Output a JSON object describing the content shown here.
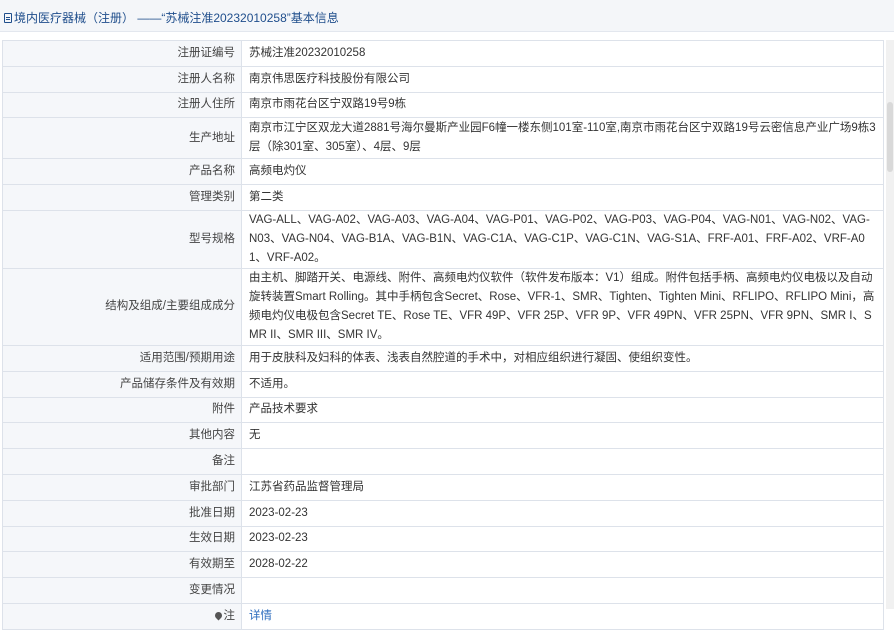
{
  "header": {
    "title": "境内医疗器械（注册） ——“苏械注准20232010258”基本信息"
  },
  "rows": [
    {
      "label": "注册证编号",
      "value": "苏械注准20232010258"
    },
    {
      "label": "注册人名称",
      "value": "南京伟思医疗科技股份有限公司"
    },
    {
      "label": "注册人住所",
      "value": "南京市雨花台区宁双路19号9栋"
    },
    {
      "label": "生产地址",
      "value": "南京市江宁区双龙大道2881号海尔曼斯产业园F6幢一楼东侧101室-110室,南京市雨花台区宁双路19号云密信息产业广场9栋3层（除301室、305室）、4层、9层"
    },
    {
      "label": "产品名称",
      "value": "高频电灼仪"
    },
    {
      "label": "管理类别",
      "value": "第二类"
    },
    {
      "label": "型号规格",
      "value": "VAG-ALL、VAG-A02、VAG-A03、VAG-A04、VAG-P01、VAG-P02、VAG-P03、VAG-P04、VAG-N01、VAG-N02、VAG-N03、VAG-N04、VAG-B1A、VAG-B1N、VAG-C1A、VAG-C1P、VAG-C1N、VAG-S1A、FRF-A01、FRF-A02、VRF-A01、VRF-A02。"
    },
    {
      "label": "结构及组成/主要组成成分",
      "value": "由主机、脚踏开关、电源线、附件、高频电灼仪软件（软件发布版本：V1）组成。附件包括手柄、高频电灼仪电极以及自动旋转装置Smart Rolling。其中手柄包含Secret、Rose、VFR-1、SMR、Tighten、Tighten Mini、RFLIPO、RFLIPO Mini，高频电灼仪电极包含Secret TE、Rose TE、VFR 49P、VFR 25P、VFR 9P、VFR 49PN、VFR 25PN、VFR 9PN、SMR I、SMR II、SMR III、SMR IV。"
    },
    {
      "label": "适用范围/预期用途",
      "value": "用于皮肤科及妇科的体表、浅表自然腔道的手术中，对相应组织进行凝固、使组织变性。"
    },
    {
      "label": "产品储存条件及有效期",
      "value": "不适用。"
    },
    {
      "label": "附件",
      "value": "产品技术要求"
    },
    {
      "label": "其他内容",
      "value": "无"
    },
    {
      "label": "备注",
      "value": ""
    },
    {
      "label": "审批部门",
      "value": "江苏省药品监督管理局"
    },
    {
      "label": "批准日期",
      "value": "2023-02-23"
    },
    {
      "label": "生效日期",
      "value": "2023-02-23"
    },
    {
      "label": "有效期至",
      "value": "2028-02-22"
    },
    {
      "label": "变更情况",
      "value": ""
    }
  ],
  "note": {
    "label": "注",
    "link_text": "详情",
    "icon": "location-pin-icon"
  },
  "colors": {
    "link": "#2a6bbd",
    "header_text": "#1f4e8c",
    "label_bg": "#f5f7fa",
    "border": "#dde2ea"
  }
}
